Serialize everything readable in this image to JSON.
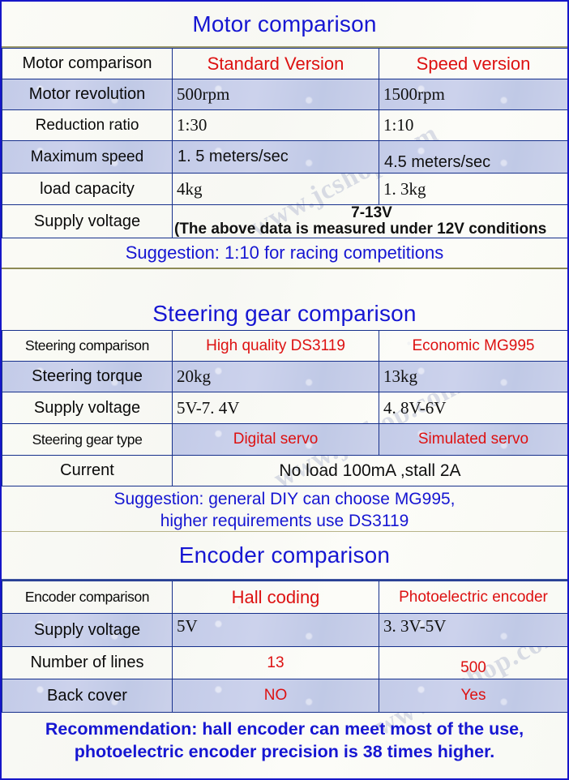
{
  "watermark": "www.jcshop.com",
  "colors": {
    "title_blue": "#1616d2",
    "header_red": "#dd1111",
    "grid_blue": "#16308c",
    "shade_blue": "#c3cbe8",
    "paper": "#fafaf5"
  },
  "sections": [
    {
      "id": "motor",
      "title": "Motor comparison",
      "table": {
        "header": [
          "Motor comparison",
          "Standard Version",
          "Speed version"
        ],
        "rows": [
          {
            "label": "Motor revolution",
            "a": "500rpm",
            "b": "1500rpm",
            "shaded": true
          },
          {
            "label": "Reduction ratio",
            "a": "1:30",
            "b": "1:10",
            "shaded": false
          },
          {
            "label": "Maximum speed",
            "a": "1. 5 meters/sec",
            "b": "4.5 meters/sec",
            "shaded": true
          },
          {
            "label": "load capacity",
            "a": "4kg",
            "b": "1. 3kg",
            "shaded": false
          }
        ],
        "merged_row": {
          "label": "Supply voltage",
          "line1": "7-13V",
          "line2": "(The above data is measured under 12V conditions"
        }
      },
      "note": "Suggestion: 1:10 for racing competitions"
    },
    {
      "id": "steering",
      "title": "Steering gear comparison",
      "table": {
        "header": [
          "Steering comparison",
          "High quality DS3119",
          "Economic MG995"
        ],
        "rows": [
          {
            "label": "Steering torque",
            "a": "20kg",
            "b": "13kg",
            "shaded": true
          },
          {
            "label": "Supply voltage",
            "a": "5V-7. 4V",
            "b": "4. 8V-6V",
            "shaded": false
          },
          {
            "label": "Steering gear type",
            "a": "Digital servo",
            "b": "Simulated servo",
            "shaded": true,
            "red": true
          }
        ],
        "merged_row": {
          "label": "Current",
          "line1": "No load 100mA  ,stall 2A",
          "line2": ""
        }
      },
      "note_line1": "Suggestion: general DIY can choose MG995,",
      "note_line2": "higher requirements use DS3119"
    },
    {
      "id": "encoder",
      "title": "Encoder comparison",
      "table": {
        "header": [
          "Encoder comparison",
          "Hall coding",
          "Photoelectric encoder"
        ],
        "rows": [
          {
            "label": "Supply voltage",
            "a": "5V",
            "b": "3. 3V-5V",
            "shaded": true
          },
          {
            "label": "Number of lines",
            "a": "13",
            "b": "500",
            "shaded": false,
            "red": true
          },
          {
            "label": "Back cover",
            "a": "NO",
            "b": "Yes",
            "shaded": true,
            "red": true
          }
        ]
      },
      "note_line1": "Recommendation: hall encoder can meet most of the use,",
      "note_line2": "photoelectric encoder precision is 38 times higher."
    }
  ]
}
